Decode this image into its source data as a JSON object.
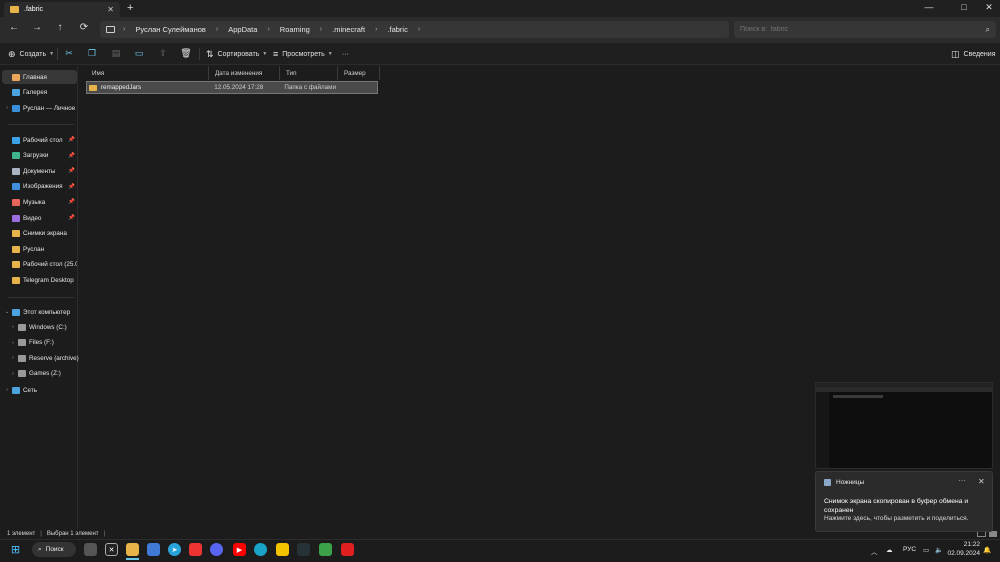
{
  "window": {
    "tab_title": ".fabric",
    "tab_close": "✕",
    "new_tab": "+",
    "controls": [
      "—",
      "□",
      "✕"
    ]
  },
  "nav": {
    "back": "←",
    "forward": "→",
    "up": "↑",
    "refresh": "⟳",
    "breadcrumb": [
      "Руслан Сулейманов",
      "AppData",
      "Roaming",
      ".minecraft",
      ".fabric"
    ],
    "chevron": "›",
    "search_placeholder": "Поиск в: .fabric"
  },
  "toolbar": {
    "create": "Создать",
    "sort": "Сортировать",
    "view": "Просмотреть",
    "more": "···",
    "details": "Сведения"
  },
  "sidebar": {
    "quick": [
      {
        "label": "Главная",
        "selected": true,
        "icon": "home-icon",
        "color": "#e8a75a"
      },
      {
        "label": "Галерея",
        "icon": "gallery-icon",
        "color": "#4aa3df"
      },
      {
        "label": "Руслан — Личное",
        "icon": "onedrive-icon",
        "color": "#3b8fd9",
        "expandable": true
      }
    ],
    "pinned": [
      {
        "label": "Рабочий стол",
        "icon": "desktop-icon",
        "color": "#3da3e8",
        "pin": true
      },
      {
        "label": "Загрузки",
        "icon": "download-icon",
        "color": "#3fb68b",
        "pin": true
      },
      {
        "label": "Документы",
        "icon": "documents-icon",
        "color": "#a9b4c2",
        "pin": true
      },
      {
        "label": "Изображения",
        "icon": "pictures-icon",
        "color": "#3f8fdc",
        "pin": true
      },
      {
        "label": "Музыка",
        "icon": "music-icon",
        "color": "#e8645a",
        "pin": true
      },
      {
        "label": "Видео",
        "icon": "video-icon",
        "color": "#9b6fe0",
        "pin": true
      },
      {
        "label": "Снимки экрана",
        "icon": "folder-icon",
        "color": "#e8b44a"
      },
      {
        "label": "Руслан",
        "icon": "folder-icon",
        "color": "#e8b44a"
      },
      {
        "label": "Рабочий стол (25.0",
        "icon": "folder-icon",
        "color": "#e8b44a"
      },
      {
        "label": "Telegram Desktop",
        "icon": "folder-icon",
        "color": "#e8b44a"
      }
    ],
    "computer": {
      "label": "Этот компьютер"
    },
    "drives": [
      {
        "label": "Windows (C:)"
      },
      {
        "label": "Files (F:)"
      },
      {
        "label": "Reserve (archive)"
      },
      {
        "label": "Games (Z:)"
      }
    ],
    "network": {
      "label": "Сеть"
    }
  },
  "files": {
    "columns": [
      "Имя",
      "Дата изменения",
      "Тип",
      "Размер"
    ],
    "rows": [
      {
        "name": "remappedJars",
        "date": "12.05.2024 17:28",
        "type": "Папка с файлами",
        "size": ""
      }
    ]
  },
  "status": {
    "count": "1 элемент",
    "selected": "Выбран 1 элемент"
  },
  "taskbar": {
    "search": "Поиск",
    "lang": "РУС",
    "time": "21:22",
    "date": "02.09.2024"
  },
  "toast": {
    "app": "Ножницы",
    "more": "···",
    "close": "✕",
    "message": "Снимок экрана скопирован в буфер обмена и сохранен",
    "sub": "Нажмите здесь, чтобы разметить и поделиться."
  }
}
